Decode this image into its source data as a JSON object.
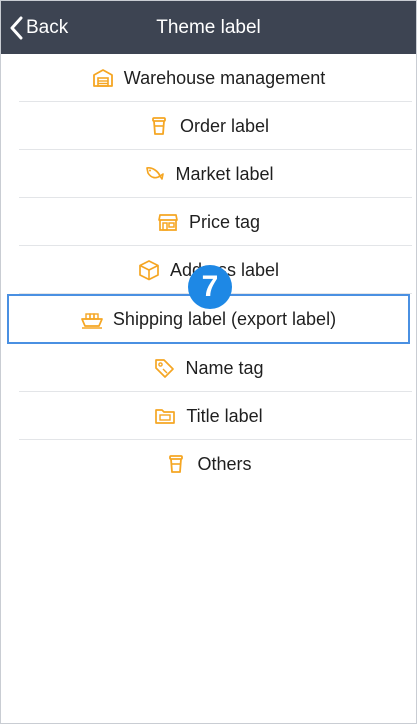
{
  "nav": {
    "back_label": "Back",
    "title": "Theme label"
  },
  "accent_color": "#F5A623",
  "highlight_color": "#4A90E2",
  "items": [
    {
      "label": "Warehouse management",
      "icon": "warehouse-icon"
    },
    {
      "label": "Order label",
      "icon": "cup-icon"
    },
    {
      "label": "Market label",
      "icon": "fish-icon"
    },
    {
      "label": "Price tag",
      "icon": "store-icon"
    },
    {
      "label": "Address label",
      "icon": "box-icon"
    },
    {
      "label": "Shipping label (export label)",
      "icon": "cargo-ship-icon"
    },
    {
      "label": "Name tag",
      "icon": "tag-icon"
    },
    {
      "label": "Title label",
      "icon": "folder-icon"
    },
    {
      "label": "Others",
      "icon": "cup-icon"
    }
  ],
  "step_badge": "7"
}
